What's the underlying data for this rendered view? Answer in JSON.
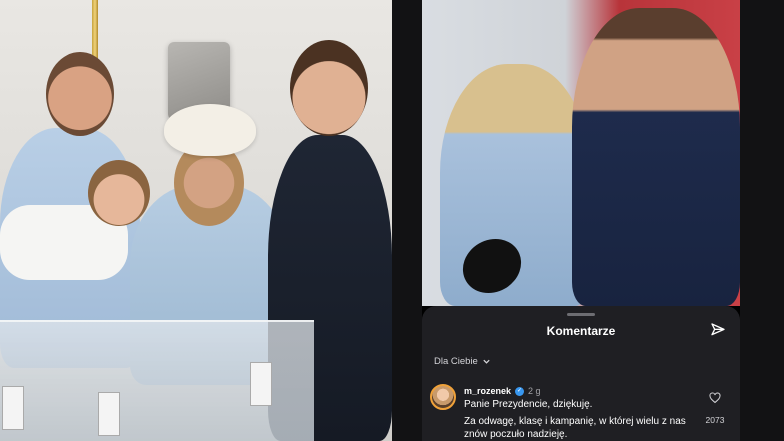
{
  "comments_sheet": {
    "title": "Komentarze",
    "send_icon": "paper-plane-icon",
    "filter_label": "Dla Ciebie",
    "filter_icon": "chevron-down-icon"
  },
  "comment": {
    "username": "m_rozenek",
    "verified_icon": "verified-badge-icon",
    "time": "2 g",
    "line1": "Panie Prezydencie, dziękuję.",
    "line2": "Za odwagę, klasę i kampanię, w której wielu z nas znów poczuło nadzieję.",
    "like_icon": "heart-icon",
    "like_count": "2073"
  },
  "colors": {
    "sheet_bg": "#1f1f23",
    "verified": "#3897f0",
    "backdrop_red": "#c94046"
  }
}
